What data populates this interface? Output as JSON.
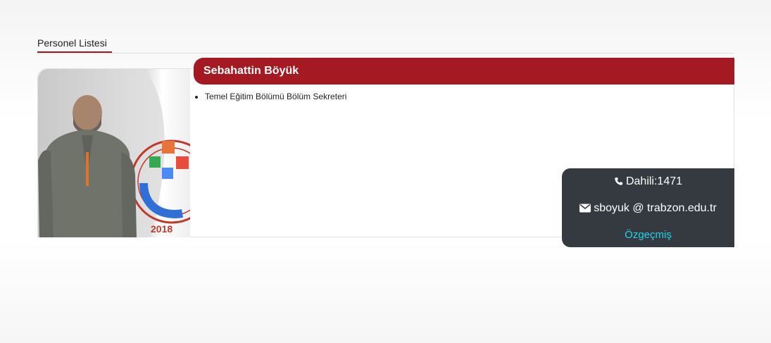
{
  "section": {
    "title": "Personel Listesi"
  },
  "person": {
    "name": "Sebahattin Böyük",
    "roles": [
      "Temel Eğitim Bölümü Bölüm Sekreteri"
    ],
    "phone": "Dahili:1471",
    "email": "sboyuk @ trabzon.edu.tr",
    "cv_label": "Özgeçmiş"
  },
  "colors": {
    "brand": "#a51a22",
    "contact_bg": "#343a40",
    "link": "#22d3e6"
  },
  "icons": [
    "phone-icon",
    "envelope-icon"
  ]
}
